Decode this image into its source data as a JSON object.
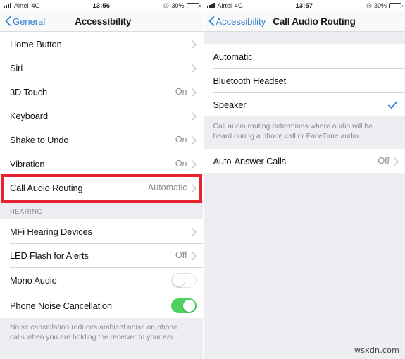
{
  "left": {
    "status_bar": {
      "signal_icon": "signal-bars-icon",
      "carrier": "Airtel",
      "network": "4G",
      "time": "13:56",
      "location_icon": "location-arrow-icon",
      "battery_percent": "30%",
      "battery_icon": "battery-icon"
    },
    "nav": {
      "back_icon": "chevron-left-icon",
      "back_label": "General",
      "title": "Accessibility"
    },
    "groups": [
      {
        "rows": [
          {
            "label": "Home Button",
            "value": "",
            "accessory": "chevron-right-icon"
          },
          {
            "label": "Siri",
            "value": "",
            "accessory": "chevron-right-icon"
          },
          {
            "label": "3D Touch",
            "value": "On",
            "accessory": "chevron-right-icon"
          },
          {
            "label": "Keyboard",
            "value": "",
            "accessory": "chevron-right-icon"
          },
          {
            "label": "Shake to Undo",
            "value": "On",
            "accessory": "chevron-right-icon"
          },
          {
            "label": "Vibration",
            "value": "On",
            "accessory": "chevron-right-icon"
          },
          {
            "label": "Call Audio Routing",
            "value": "Automatic",
            "accessory": "chevron-right-icon"
          }
        ]
      },
      {
        "header": "HEARING",
        "rows": [
          {
            "label": "MFi Hearing Devices",
            "value": "",
            "accessory": "chevron-right-icon"
          },
          {
            "label": "LED Flash for Alerts",
            "value": "Off",
            "accessory": "chevron-right-icon"
          },
          {
            "label": "Mono Audio",
            "value": "",
            "accessory": "toggle-off"
          },
          {
            "label": "Phone Noise Cancellation",
            "value": "",
            "accessory": "toggle-on"
          }
        ],
        "footer": "Noise cancellation reduces ambient noise on phone calls when you are holding the receiver to your ear."
      }
    ],
    "highlight_target": "Call Audio Routing"
  },
  "right": {
    "status_bar": {
      "signal_icon": "signal-bars-icon",
      "carrier": "Airtel",
      "network": "4G",
      "time": "13:57",
      "location_icon": "location-arrow-icon",
      "battery_percent": "30%",
      "battery_icon": "battery-icon"
    },
    "nav": {
      "back_icon": "chevron-left-icon",
      "back_label": "Accessibility",
      "title": "Call Audio Routing"
    },
    "groups": [
      {
        "rows": [
          {
            "label": "Automatic",
            "value": "",
            "accessory": "none"
          },
          {
            "label": "Bluetooth Headset",
            "value": "",
            "accessory": "none"
          },
          {
            "label": "Speaker",
            "value": "",
            "accessory": "checkmark-icon"
          }
        ],
        "footer": "Call audio routing determines where audio will be heard during a phone call or FaceTime audio."
      },
      {
        "rows": [
          {
            "label": "Auto-Answer Calls",
            "value": "Off",
            "accessory": "chevron-right-icon"
          }
        ]
      }
    ]
  },
  "watermark": "wsxdn.com",
  "colors": {
    "accent_blue": "#2f7fd8",
    "toggle_on_green": "#4cd45f",
    "highlight_red": "#e8212f",
    "background_grey": "#eeeef2"
  }
}
